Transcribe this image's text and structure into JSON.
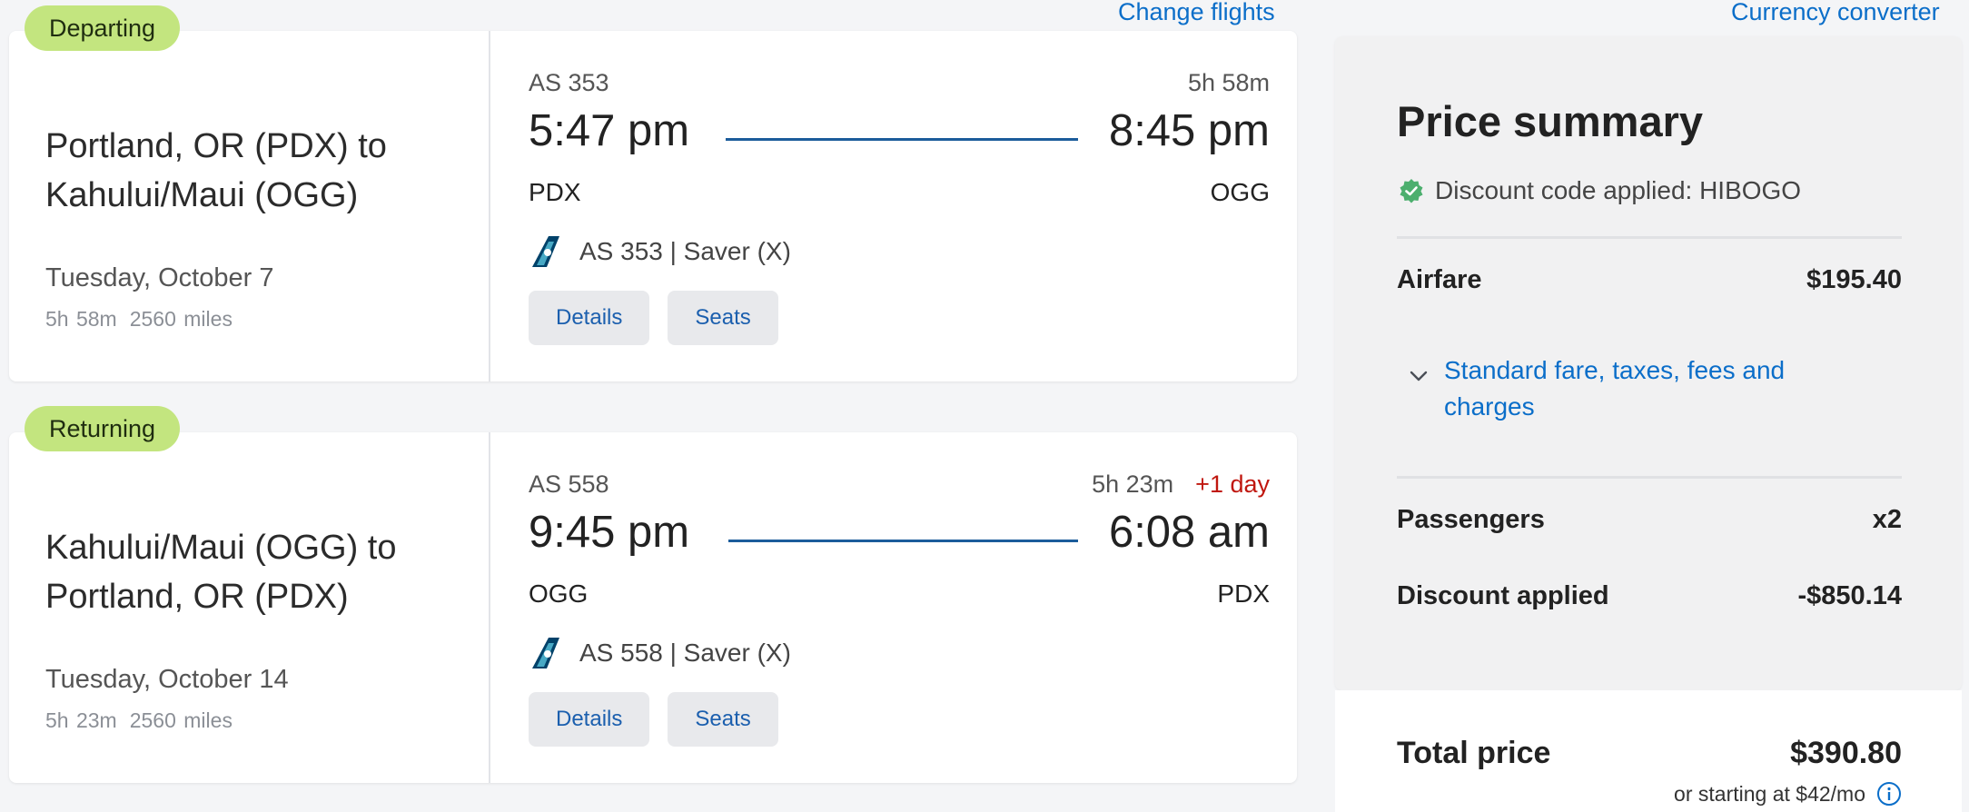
{
  "links": {
    "change_flights": "Change flights",
    "currency_converter": "Currency converter"
  },
  "departing": {
    "badge": "Departing",
    "route": "Portland, OR (PDX) to Kahului/Maui (OGG)",
    "date": "Tuesday, October 7",
    "duration": "5h 58m",
    "distance": "2560 miles",
    "flight_number": "AS 353",
    "flight_duration": "5h 58m",
    "depart_time": "5:47 pm",
    "arrive_time": "8:45 pm",
    "depart_airport": "PDX",
    "arrive_airport": "OGG",
    "carrier_info": "AS 353 | Saver (X)",
    "details_label": "Details",
    "seats_label": "Seats"
  },
  "returning": {
    "badge": "Returning",
    "route": "Kahului/Maui (OGG) to Portland, OR (PDX)",
    "date": "Tuesday, October 14",
    "duration": "5h 23m",
    "distance": "2560 miles",
    "flight_number": "AS 558",
    "flight_duration": "5h 23m",
    "next_day": "+1 day",
    "depart_time": "9:45 pm",
    "arrive_time": "6:08 am",
    "depart_airport": "OGG",
    "arrive_airport": "PDX",
    "carrier_info": "AS 558 | Saver (X)",
    "details_label": "Details",
    "seats_label": "Seats"
  },
  "price_summary": {
    "title": "Price summary",
    "discount_code": "Discount code applied: HIBOGO",
    "airfare_label": "Airfare",
    "airfare_value": "$195.40",
    "fare_breakdown_link": "Standard fare, taxes, fees and charges",
    "passengers_label": "Passengers",
    "passengers_value": "x2",
    "discount_label": "Discount applied",
    "discount_value": "-$850.14",
    "total_label": "Total price",
    "total_value": "$390.80",
    "financing_text": "or starting at $42/mo"
  },
  "colors": {
    "badge": "#c3e57f",
    "link": "#0b6ec9",
    "route_line": "#1b5c9b",
    "next_day": "#c0170f",
    "check": "#4caf6e"
  },
  "icons": {
    "tail": "alaska-tail-icon",
    "check": "verified-check-icon",
    "chevron": "chevron-down-icon",
    "info": "info-icon"
  }
}
